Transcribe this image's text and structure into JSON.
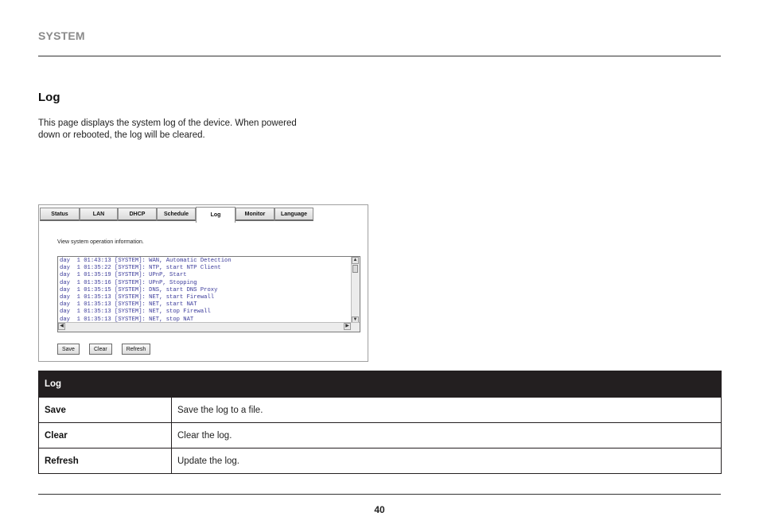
{
  "header": {
    "section": "SYSTEM"
  },
  "content": {
    "title": "Log",
    "intro": "This page displays the system log of the device. When powered down or rebooted, the log will be cleared."
  },
  "screenshot": {
    "tabs": [
      {
        "label": "Status",
        "active": false
      },
      {
        "label": "LAN",
        "active": false
      },
      {
        "label": "DHCP",
        "active": false
      },
      {
        "label": "Schedule",
        "active": false
      },
      {
        "label": "Log",
        "active": true
      },
      {
        "label": "Monitor",
        "active": false
      },
      {
        "label": "Language",
        "active": false
      }
    ],
    "caption": "View system operation information.",
    "log_lines": [
      "day  1 01:43:13 [SYSTEM]: WAN, Automatic Detection",
      "day  1 01:35:22 [SYSTEM]: NTP, start NTP Client",
      "day  1 01:35:19 [SYSTEM]: UPnP, Start",
      "day  1 01:35:16 [SYSTEM]: UPnP, Stopping",
      "day  1 01:35:15 [SYSTEM]: DNS, start DNS Proxy",
      "day  1 01:35:13 [SYSTEM]: NET, start Firewall",
      "day  1 01:35:13 [SYSTEM]: NET, start NAT",
      "day  1 01:35:13 [SYSTEM]: NET, stop Firewall",
      "day  1 01:35:13 [SYSTEM]: NET, stop NAT"
    ],
    "buttons": {
      "save": "Save",
      "clear": "Clear",
      "refresh": "Refresh"
    }
  },
  "table": {
    "header": "Log",
    "rows": [
      {
        "term": "Save",
        "desc": "Save the log to a file."
      },
      {
        "term": "Clear",
        "desc": "Clear the log."
      },
      {
        "term": "Refresh",
        "desc": "Update the log."
      }
    ]
  },
  "footer": {
    "page": "40"
  }
}
